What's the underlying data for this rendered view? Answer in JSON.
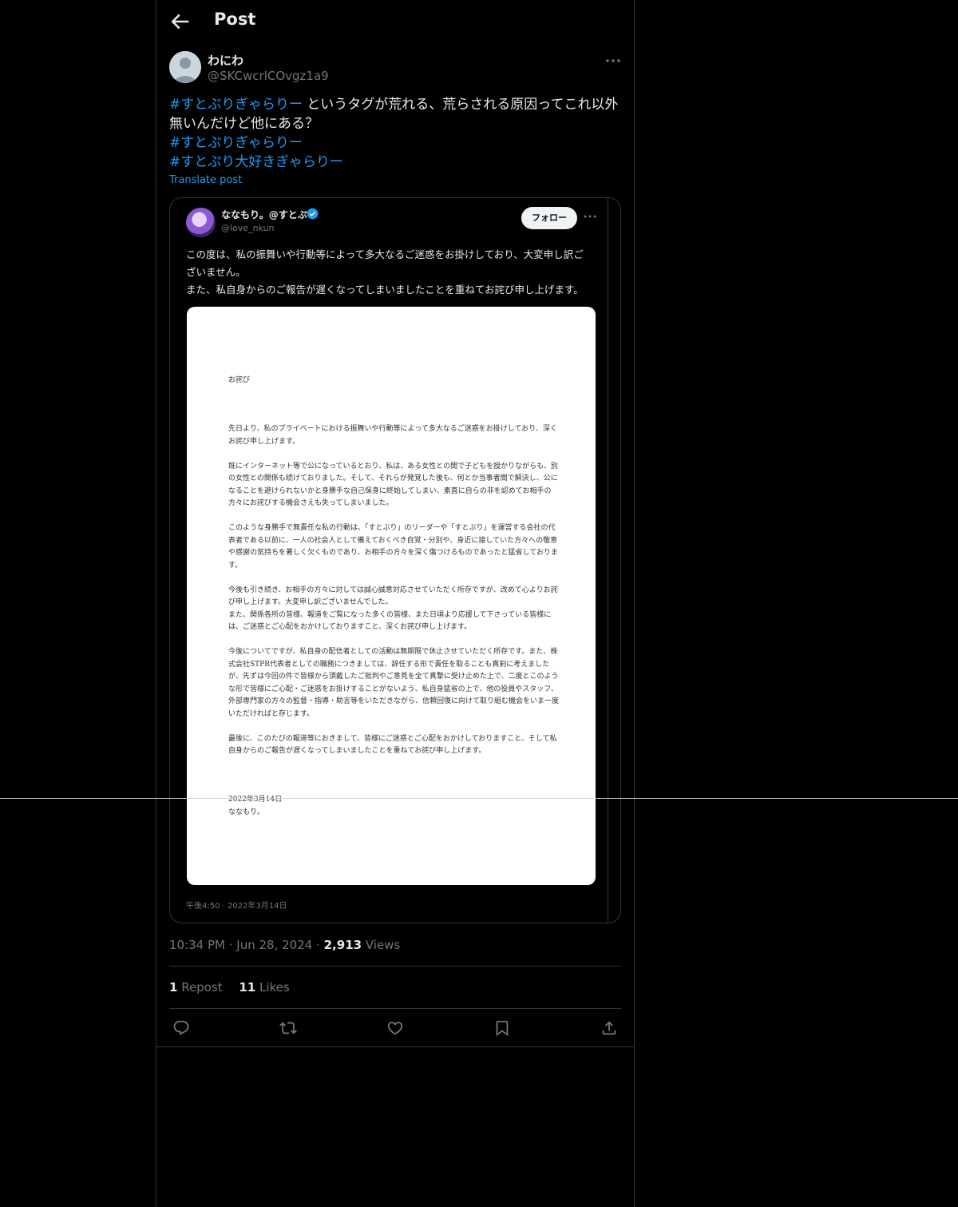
{
  "header": {
    "title": "Post"
  },
  "author": {
    "name": "わにわ",
    "handle": "@SKCwcrlCOvgz1a9"
  },
  "tweet": {
    "hashtag_1": "#すとぷりぎゃらりー",
    "text_1": " というタグが荒れる、荒らされる原因ってこれ以外無いんだけど他にある？",
    "hashtag_2": "#すとぷりぎゃらりー",
    "hashtag_3": "#すとぷり大好きぎゃらりー",
    "translate": "Translate post"
  },
  "embed": {
    "name": "ななもり。@すとぷり",
    "handle": "@love_nkun",
    "follow_label": "フォロー",
    "text_line_1": "この度は、私の振舞いや行動等によって多大なるご迷惑をお掛けしており、大変申し訳ございません。",
    "text_line_2": "また、私自身からのご報告が遅くなってしまいましたことを重ねてお詫び申し上げます。",
    "timestamp": "午後4:50 · 2022年3月14日",
    "document": {
      "title": "お詫び",
      "paragraphs": [
        "先日より、私のプライベートにおける振舞いや行動等によって多大なるご迷惑をお掛けしており、深くお詫び申し上げます。",
        "既にインターネット等で公になっているとおり、私は、ある女性との間で子どもを授かりながらも、別の女性との関係も続けておりました。そして、それらが発覚した後も、何とか当事者間で解決し、公になることを避けられないかと身勝手な自己保身に終始してしまい、素直に自らの非を認めてお相手の方々にお詫びする機会さえも失ってしまいました。",
        "このような身勝手で無責任な私の行動は、「すとぷり」のリーダーや「すとぷり」を運営する会社の代表者である以前に、一人の社会人として備えておくべき自覚・分別や、身近に接していた方々への敬意や感謝の気持ちを著しく欠くものであり、お相手の方々を深く傷つけるものであったと猛省しております。",
        "今後も引き続き、お相手の方々に対しては誠心誠意対応させていただく所存ですが、改めて心よりお詫び申し上げます。大変申し訳ございませんでした。\nまた、関係各所の皆様、報道をご覧になった多くの皆様、また日頃より応援して下さっている皆様には、ご迷惑とご心配をおかけしておりますこと、深くお詫び申し上げます。",
        "今後についてですが、私自身の配信者としての活動は無期限で休止させていただく所存です。また、株式会社STPR代表者としての職務につきましては、辞任する形で責任を取ることも真剣に考えましたが、先ずは今回の件で皆様から頂戴したご批判やご意見を全て真摯に受け止めた上で、二度とこのような形で皆様にご心配・ご迷惑をお掛けすることがないよう、私自身猛省の上で、他の役員やスタッフ、外部専門家の方々の監督・指導・助言等をいただきながら、信頼回復に向けて取り組む機会をいま一度いただければと存じます。",
        "最後に、このたびの報道等におきまして、皆様にご迷惑とご心配をおかけしておりますこと、そして私自身からのご報告が遅くなってしまいましたことを重ねてお詫び申し上げます。"
      ],
      "date": "2022年3月14日",
      "signature": "ななもり。"
    }
  },
  "meta": {
    "time": "10:34 PM",
    "sep_1": " · ",
    "date": "Jun 28, 2024",
    "sep_2": " · ",
    "views_count": "2,913",
    "views_label": " Views"
  },
  "stats": {
    "reposts_count": "1",
    "reposts_label": " Repost",
    "likes_count": "11",
    "likes_label": " Likes"
  },
  "colors": {
    "background": "#000000",
    "text": "#e7e9ea",
    "muted": "#71767b",
    "accent": "#1d9bf0",
    "border": "#2f3336"
  }
}
